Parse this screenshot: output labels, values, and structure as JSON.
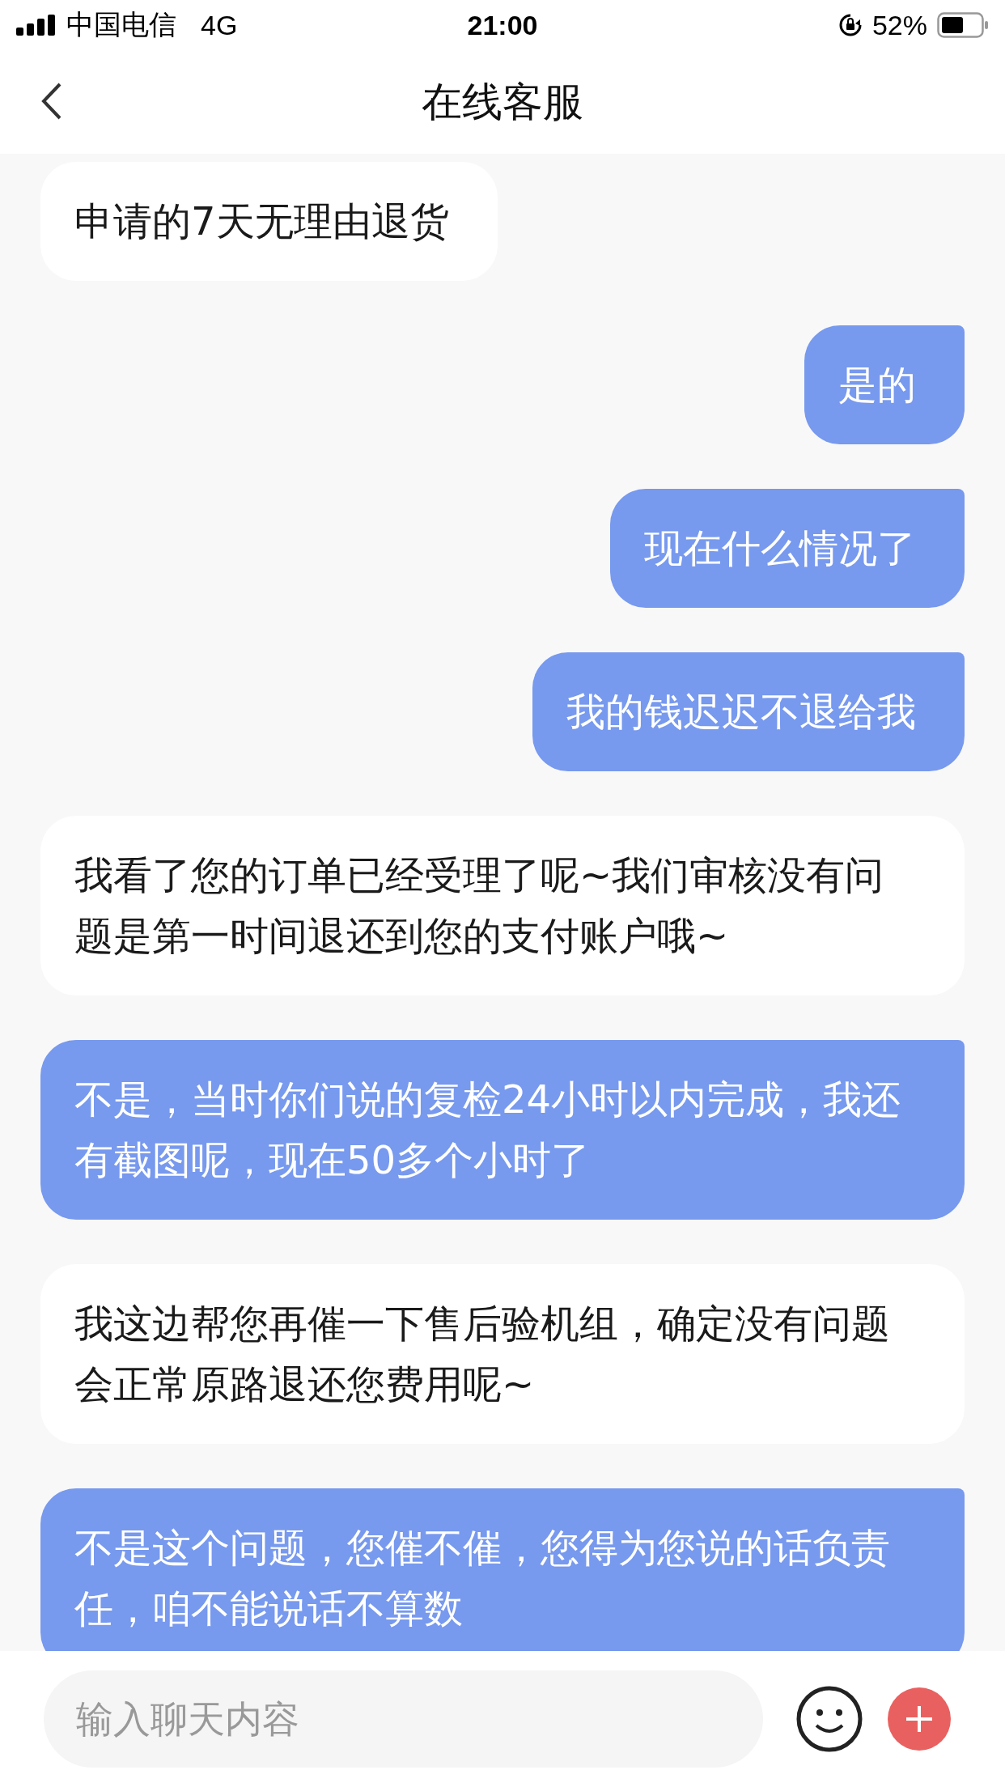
{
  "status_bar": {
    "carrier": "中国电信",
    "network": "4G",
    "time": "21:00",
    "battery": "52%"
  },
  "nav": {
    "title": "在线客服"
  },
  "messages": [
    {
      "kind": "agent",
      "text": "申请的7天无理由退货"
    },
    {
      "kind": "user",
      "text": "是的"
    },
    {
      "kind": "user",
      "text": "现在什么情况了"
    },
    {
      "kind": "user",
      "text": "我的钱迟迟不退给我"
    },
    {
      "kind": "agent",
      "text": "我看了您的订单已经受理了呢~我们审核没有问题是第一时间退还到您的支付账户哦~"
    },
    {
      "kind": "user",
      "text": "不是，当时你们说的复检24小时以内完成，我还有截图呢，现在50多个小时了"
    },
    {
      "kind": "agent",
      "text": "我这边帮您再催一下售后验机组，确定没有问题会正常原路退还您费用呢~"
    },
    {
      "kind": "user",
      "text": "不是这个问题，您催不催，您得为您说的话负责任，咱不能说话不算数"
    }
  ],
  "input": {
    "placeholder": "输入聊天内容"
  }
}
